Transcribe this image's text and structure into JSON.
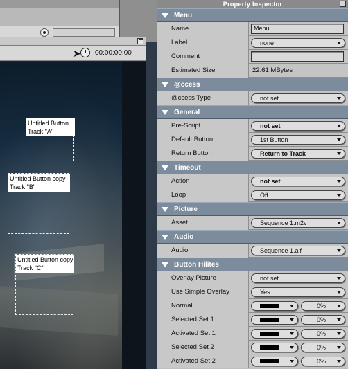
{
  "editor": {
    "timecode": "00:00:00:00",
    "buttons": [
      {
        "line1": "Untitled Button",
        "line2": "Track \"A\""
      },
      {
        "line1": "Untitled Button copy",
        "line2": "Track \"B\""
      },
      {
        "line1": "Untitled Button copy",
        "line2": "Track \"C\""
      }
    ]
  },
  "inspector": {
    "title": "Property Inspector",
    "sections": {
      "menu": {
        "title": "Menu",
        "name_label": "Name",
        "name_value": "Menu",
        "label_label": "Label",
        "label_value": "none",
        "comment_label": "Comment",
        "comment_value": "",
        "size_label": "Estimated Size",
        "size_value": "22.61 MBytes"
      },
      "access": {
        "title": "@ccess",
        "type_label": "@ccess Type",
        "type_value": "not set"
      },
      "general": {
        "title": "General",
        "prescript_label": "Pre-Script",
        "prescript_value": "not set",
        "default_label": "Default Button",
        "default_value": "1st Button",
        "return_label": "Return Button",
        "return_value": "Return to Track"
      },
      "timeout": {
        "title": "Timeout",
        "action_label": "Action",
        "action_value": "not set",
        "loop_label": "Loop",
        "loop_value": "Off"
      },
      "picture": {
        "title": "Picture",
        "asset_label": "Asset",
        "asset_value": "Sequence 1.m2v"
      },
      "audio": {
        "title": "Audio",
        "audio_label": "Audio",
        "audio_value": "Sequence 1.aif"
      },
      "hilites": {
        "title": "Button Hilites",
        "overlay_label": "Overlay Picture",
        "overlay_value": "not set",
        "simple_label": "Use Simple Overlay",
        "simple_value": "Yes",
        "rows": [
          {
            "label": "Normal",
            "color": "#000000",
            "opacity": "0%"
          },
          {
            "label": "Selected Set 1",
            "color": "#000000",
            "opacity": "0%"
          },
          {
            "label": "Activated Set 1",
            "color": "#000000",
            "opacity": "0%"
          },
          {
            "label": "Selected Set 2",
            "color": "#000000",
            "opacity": "0%"
          },
          {
            "label": "Activated Set 2",
            "color": "#000000",
            "opacity": "0%"
          }
        ]
      }
    }
  }
}
